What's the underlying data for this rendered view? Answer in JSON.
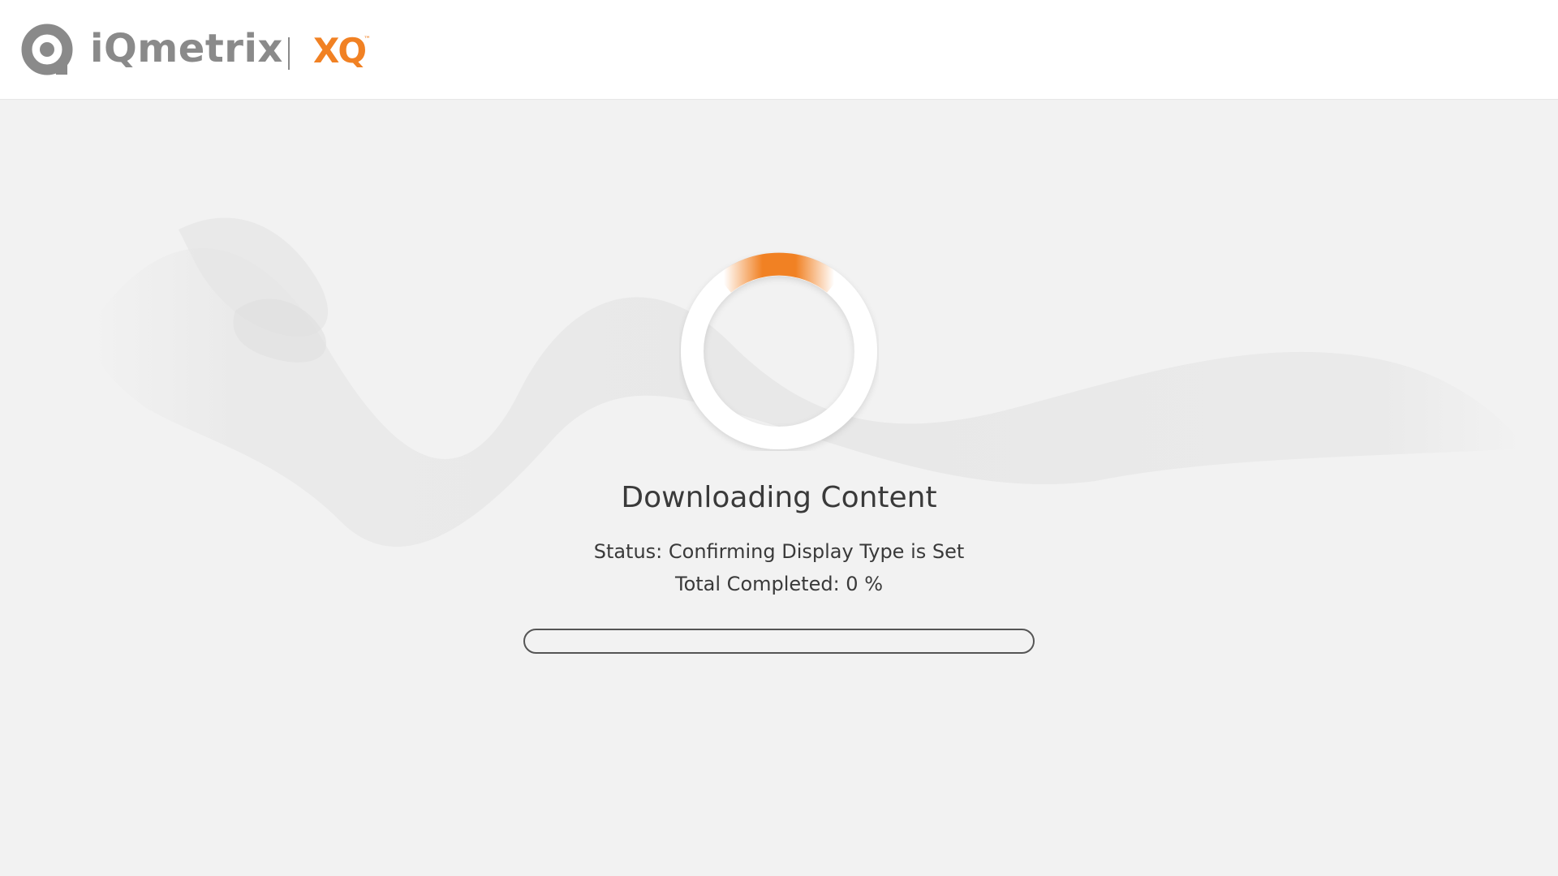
{
  "header": {
    "brand": "iQmetrix",
    "product": "XQ",
    "product_tm": "™"
  },
  "main": {
    "title": "Downloading Content",
    "status": "Status: Confirming Display Type is Set",
    "total_completed": "Total Completed: 0 %",
    "progress_percent": 0
  },
  "colors": {
    "accent": "#f18123",
    "brand_gray": "#8a8a8a",
    "text": "#3a3a3a",
    "background": "#f2f2f2"
  },
  "icons": {
    "logo": "iqmetrix-q-logo-icon",
    "spinner": "loading-spinner-icon"
  }
}
